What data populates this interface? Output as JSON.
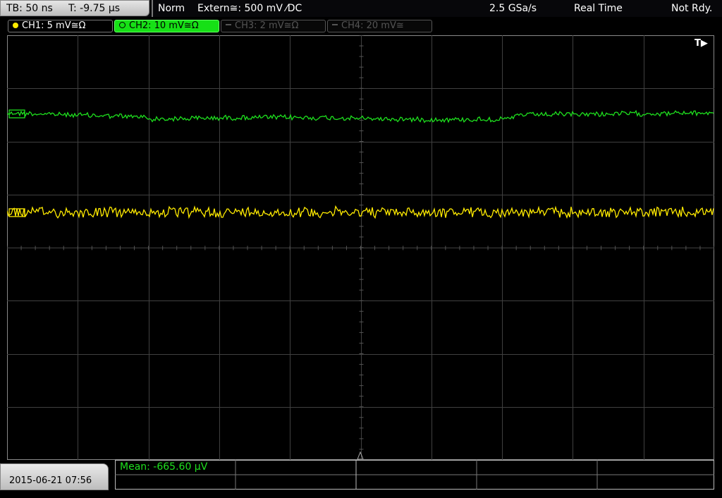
{
  "status": {
    "timebase": "TB: 50 ns",
    "trigger_offset": "T: -9.75 µs",
    "mode": "Norm",
    "trigger_source": "Extern≅: 500 mV ⁄DC",
    "sample_rate": "2.5 GSa/s",
    "acq_mode": "Real Time",
    "state": "Not Rdy."
  },
  "channels": [
    {
      "label": "CH1: 5 mV≅Ω",
      "color": "#ffeb00"
    },
    {
      "label": "CH2: 10 mV≅Ω",
      "color": "#1ee01e"
    },
    {
      "label": "CH3: 2 mV≅Ω",
      "color": "#555555"
    },
    {
      "label": "CH4: 20 mV≅",
      "color": "#555555"
    }
  ],
  "trigger_marker": "T▶",
  "measurement": {
    "text": "Mean: -665.60 µV",
    "color": "#1ee01e"
  },
  "date": "2015-06-21 07:56",
  "icons": {
    "trigger-position": "triangle-up",
    "ch-marker": "box"
  }
}
